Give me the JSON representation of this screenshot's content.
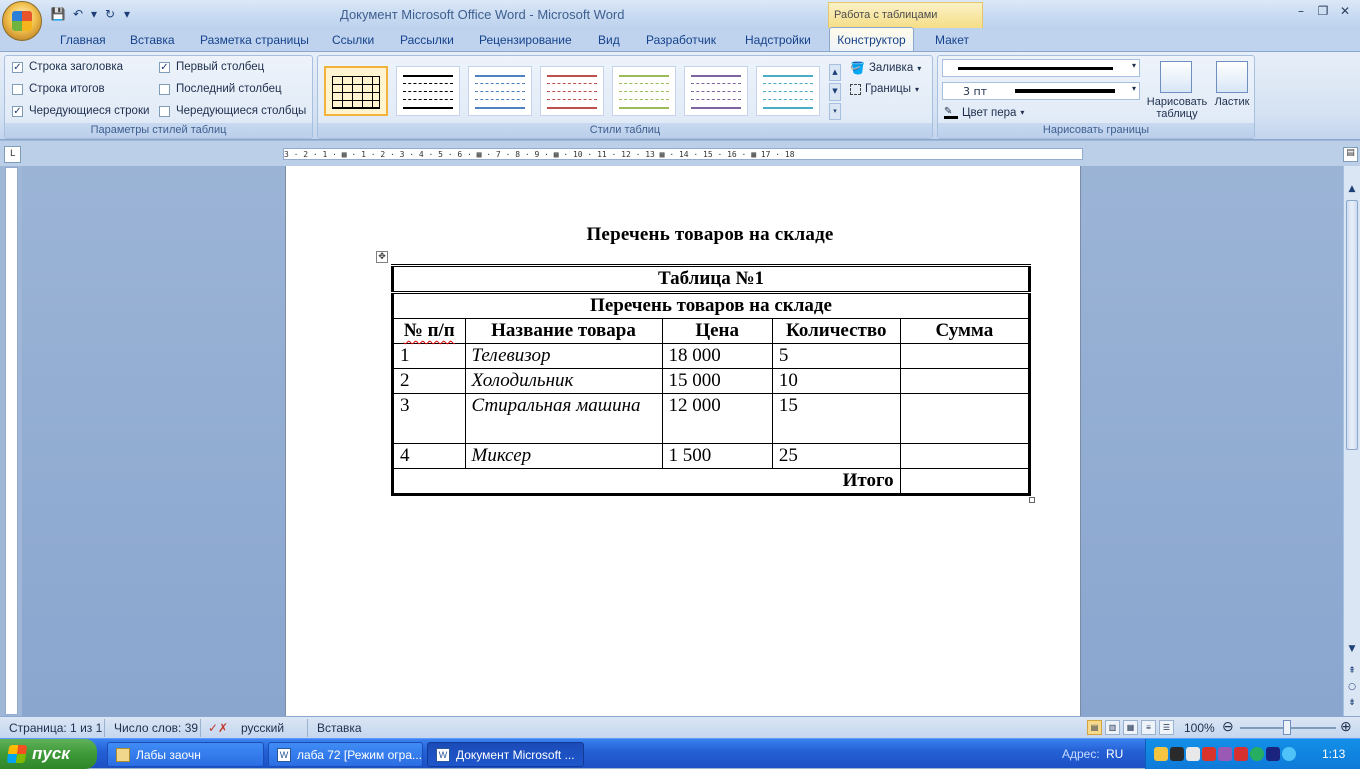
{
  "window": {
    "title": "Документ Microsoft Office Word - Microsoft Word",
    "contextual_group": "Работа с таблицами",
    "minimize": "–",
    "restore": "❐",
    "close": "✕"
  },
  "qat": {
    "save": "💾",
    "undo": "↶",
    "undo_drop": "▾",
    "redo": "↻",
    "customize": "▾"
  },
  "tabs": [
    {
      "label": "Главная"
    },
    {
      "label": "Вставка"
    },
    {
      "label": "Разметка страницы"
    },
    {
      "label": "Ссылки"
    },
    {
      "label": "Рассылки"
    },
    {
      "label": "Рецензирование"
    },
    {
      "label": "Вид"
    },
    {
      "label": "Разработчик"
    },
    {
      "label": "Надстройки"
    },
    {
      "label": "Конструктор"
    },
    {
      "label": "Макет"
    }
  ],
  "help": "?",
  "ribbon": {
    "style_options": {
      "label": "Параметры стилей таблиц",
      "items": [
        {
          "label": "Строка заголовка",
          "checked": "✓"
        },
        {
          "label": "Строка итогов",
          "checked": ""
        },
        {
          "label": "Чередующиеся строки",
          "checked": "✓"
        },
        {
          "label": "Первый столбец",
          "checked": "✓"
        },
        {
          "label": "Последний столбец",
          "checked": ""
        },
        {
          "label": "Чередующиеся столбцы",
          "checked": ""
        }
      ]
    },
    "table_styles": {
      "label": "Стили таблиц",
      "shading": "Заливка",
      "borders": "Границы",
      "thumb_colors": [
        "#000000",
        "#000000",
        "#4f81bd",
        "#c0504d",
        "#9bbb59",
        "#8064a2",
        "#4bacc6"
      ]
    },
    "draw_borders": {
      "label": "Нарисовать границы",
      "pen_weight": "3 пт",
      "pen_color": "Цвет пера",
      "draw_table": "Нарисовать таблицу",
      "eraser": "Ластик"
    }
  },
  "ruler": {
    "marks": "3 · 2 · 1 · ▦ · 1 · 2 · 3 · 4 · 5 · 6 · ▦ · 7 · 8 · 9 · ▦ · 10 · 11 · 12 · 13 ▦ · 14 · 15 · 16 · ▦ 17 · 18",
    "tab_selector": "L"
  },
  "document": {
    "heading": "Перечень товаров  на складе",
    "table": {
      "title": "Таблица №1",
      "subtitle": "Перечень товаров  на складе",
      "headers": [
        "№ п/п",
        "Название товара",
        "Цена",
        "Количество",
        "Сумма"
      ],
      "rows": [
        [
          "1",
          "Телевизор",
          "18 000",
          "5",
          ""
        ],
        [
          "2",
          "Холодильник",
          "15 000",
          "10",
          ""
        ],
        [
          "3",
          "Стиральная машина",
          "12 000",
          "15",
          ""
        ],
        [
          "4",
          "Миксер",
          "1 500",
          "25",
          ""
        ]
      ],
      "total_label": "Итого"
    }
  },
  "statusbar": {
    "page": "Страница: 1 из 1",
    "words": "Число слов: 39",
    "language": "русский",
    "mode": "Вставка",
    "zoom": "100%"
  },
  "taskbar": {
    "start": "пуск",
    "tasks": [
      {
        "label": "Лабы заочн"
      },
      {
        "label": "лаба 72 [Режим огра..."
      },
      {
        "label": "Документ Microsoft ..."
      }
    ],
    "address_label": "Адрес:",
    "lang": "RU",
    "clock": "1:13"
  }
}
